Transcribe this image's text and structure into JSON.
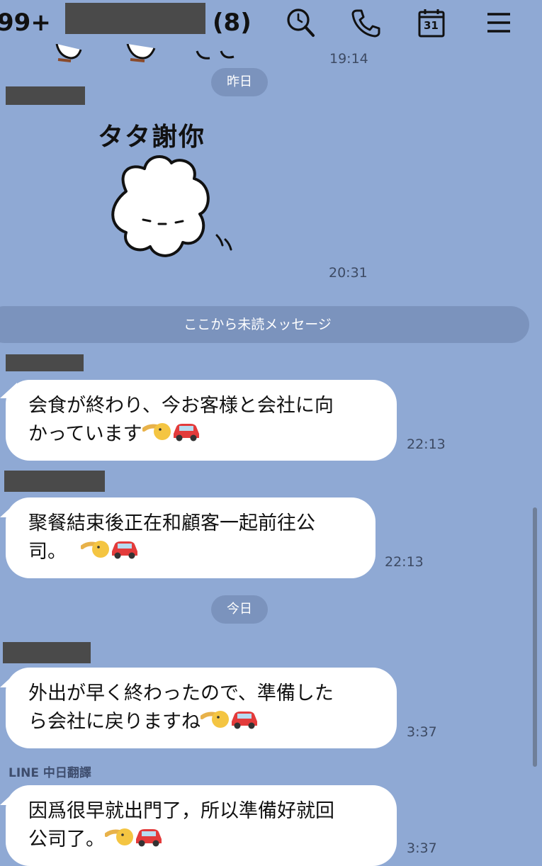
{
  "header": {
    "unread_count": "99+",
    "member_count": "(8)",
    "icons": [
      "search-icon",
      "phone-icon",
      "calendar-icon",
      "menu-icon"
    ],
    "calendar_day": "31"
  },
  "timeline": {
    "top_time": "19:14",
    "date_yesterday": "昨日",
    "sticker_text": "タタ謝你",
    "sticker_time": "20:31",
    "unread_divider": "ここから未読メッセージ",
    "date_today": "今日",
    "translation_label": "LINE 中日翻譯"
  },
  "messages": [
    {
      "line1": "会食が終わり、今お客様と会社に向",
      "line2": "かっています",
      "time": "22:13"
    },
    {
      "line1": "聚餐結束後正在和顧客一起前往公",
      "line2": "司。",
      "time": "22:13"
    },
    {
      "line1": "外出が早く終わったので、準備した",
      "line2": "ら会社に戻りますね",
      "time": "3:37"
    },
    {
      "line1": "因爲很早就出門了，所以準備好就回",
      "line2": "公司了。",
      "time": "3:37"
    }
  ],
  "colors": {
    "background": "#8fa9d4",
    "pill": "#7b93bd",
    "bubble": "#ffffff",
    "redaction": "#4a4a4a"
  }
}
